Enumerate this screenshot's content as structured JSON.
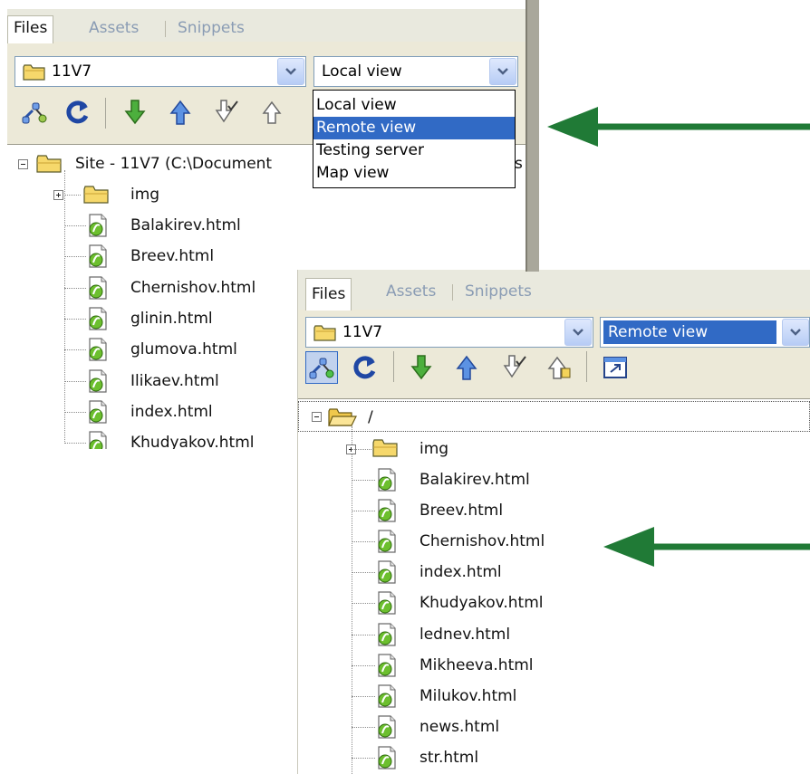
{
  "colors": {
    "arrow": "#207a36",
    "selection": "#316ac5",
    "panel_bg": "#ece9d8"
  },
  "top_panel": {
    "tabs": [
      "Files",
      "Assets",
      "Snippets"
    ],
    "site_combo": "11V7",
    "view_combo": "Local view",
    "view_options": [
      "Local view",
      "Remote view",
      "Testing server",
      "Map view"
    ],
    "highlighted_option": "Remote view",
    "root_label": "Site - 11V7 (C:\\Document",
    "root_label_tail": "s",
    "items": [
      "img",
      "Balakirev.html",
      "Breev.html",
      "Chernishov.html",
      "glinin.html",
      "glumova.html",
      "Ilikaev.html",
      "index.html",
      "Khudyakov.html"
    ]
  },
  "bottom_panel": {
    "tabs": [
      "Files",
      "Assets",
      "Snippets"
    ],
    "site_combo": "11V7",
    "view_combo": "Remote view",
    "root_label": "/",
    "items": [
      "img",
      "Balakirev.html",
      "Breev.html",
      "Chernishov.html",
      "index.html",
      "Khudyakov.html",
      "lednev.html",
      "Mikheeva.html",
      "Milukov.html",
      "news.html",
      "str.html"
    ]
  },
  "icons": {
    "connect": "connect-icon",
    "refresh": "refresh-icon",
    "get": "get-file-icon",
    "put": "put-file-icon",
    "checkout": "check-out-icon",
    "checkin": "check-in-icon",
    "expand": "expand-view-icon",
    "folder": "folder-icon",
    "html_file": "html-file-icon"
  }
}
